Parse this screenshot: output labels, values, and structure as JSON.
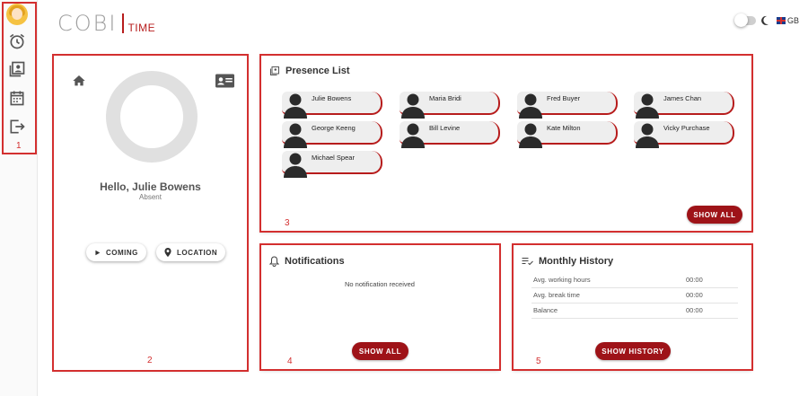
{
  "app": {
    "logo_main": "COBI",
    "logo_sub": "TIME"
  },
  "header": {
    "language": "GB"
  },
  "sidebar": {
    "items": [
      {
        "icon": "avatar"
      },
      {
        "icon": "alarm-icon"
      },
      {
        "icon": "presence-list-icon"
      },
      {
        "icon": "calendar-icon"
      },
      {
        "icon": "logout-icon"
      }
    ]
  },
  "markers": {
    "m1": "1",
    "m2": "2",
    "m3": "3",
    "m4": "4",
    "m5": "5"
  },
  "profile": {
    "greeting": "Hello, Julie Bowens",
    "status": "Absent",
    "coming_label": "COMING",
    "location_label": "LOCATION"
  },
  "presence": {
    "title": "Presence List",
    "people": [
      "Julie Bowens",
      "Maria Bridi",
      "Fred Buyer",
      "James Chan",
      "George Keeng",
      "Bill Levine",
      "Kate Milton",
      "Vicky Purchase",
      "Michael Spear"
    ],
    "show_all": "SHOW ALL"
  },
  "notifications": {
    "title": "Notifications",
    "empty": "No notification received",
    "show_all": "SHOW ALL"
  },
  "history": {
    "title": "Monthly History",
    "rows": [
      {
        "label": "Avg. working hours",
        "value": "00:00"
      },
      {
        "label": "Avg. break time",
        "value": "00:00"
      },
      {
        "label": "Balance",
        "value": "00:00"
      }
    ],
    "show_history": "SHOW HISTORY"
  },
  "colors": {
    "accent": "#9e1318",
    "highlight": "#d32f2f"
  }
}
